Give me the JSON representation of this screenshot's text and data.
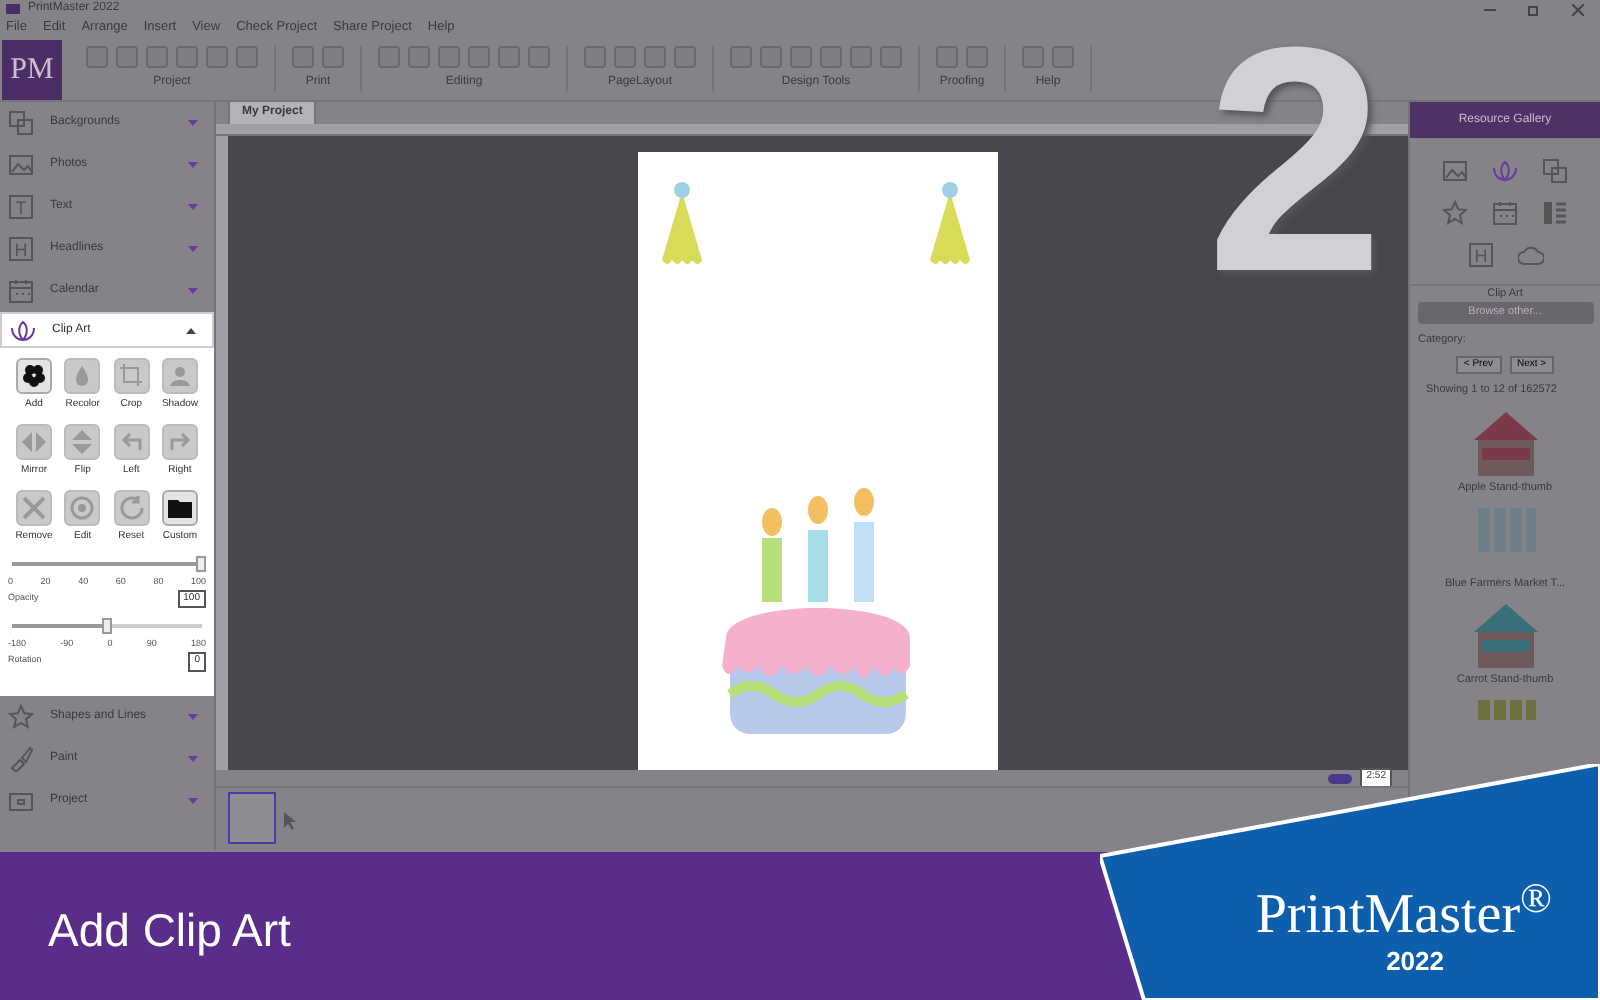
{
  "window": {
    "title": "PrintMaster 2022"
  },
  "menu": [
    "File",
    "Edit",
    "Arrange",
    "Insert",
    "View",
    "Check Project",
    "Share Project",
    "Help"
  ],
  "ribbon": {
    "logo": "PM",
    "groups": [
      {
        "label": "Project"
      },
      {
        "label": "Print"
      },
      {
        "label": "Editing"
      },
      {
        "label": "PageLayout"
      },
      {
        "label": "Design Tools"
      },
      {
        "label": "Proofing"
      },
      {
        "label": "Help"
      }
    ]
  },
  "document_tab": {
    "label": "My Project",
    "selected": true
  },
  "left_panel": {
    "sections": [
      {
        "label": "Backgrounds",
        "expanded": false
      },
      {
        "label": "Photos",
        "expanded": false
      },
      {
        "label": "Text",
        "icon_text": "T",
        "expanded": false
      },
      {
        "label": "Headlines",
        "icon_text": "H",
        "expanded": false
      },
      {
        "label": "Calendar",
        "expanded": false
      },
      {
        "label": "Clip Art",
        "expanded": true,
        "tools": [
          {
            "label": "Add",
            "disabled": false
          },
          {
            "label": "Recolor",
            "disabled": true
          },
          {
            "label": "Crop",
            "disabled": true
          },
          {
            "label": "Shadow",
            "disabled": true
          },
          {
            "label": "Mirror",
            "disabled": true
          },
          {
            "label": "Flip",
            "disabled": true
          },
          {
            "label": "Left",
            "disabled": true
          },
          {
            "label": "Right",
            "disabled": true
          },
          {
            "label": "Remove",
            "disabled": true
          },
          {
            "label": "Edit",
            "disabled": true
          },
          {
            "label": "Reset",
            "disabled": true
          },
          {
            "label": "Custom",
            "disabled": false
          }
        ],
        "sliders": [
          {
            "label": "Opacity",
            "level": 1,
            "value": "100",
            "ticks": [
              "0",
              "20",
              "40",
              "60",
              "80",
              "100"
            ]
          },
          {
            "label": "Rotation",
            "level": 0.5,
            "value": "0",
            "ticks": [
              "-180",
              "-90",
              "0",
              "90",
              "180"
            ]
          }
        ]
      },
      {
        "label": "Shapes and Lines",
        "expanded": false
      },
      {
        "label": "Paint",
        "expanded": false
      },
      {
        "label": "Project",
        "expanded": false
      }
    ]
  },
  "zoom": {
    "value": "2:52"
  },
  "pages": [
    {
      "selected": true
    }
  ],
  "resource_gallery": {
    "title": "Resource Gallery",
    "icon_text": "H",
    "section": "Clip Art",
    "browse_button": "Browse other...",
    "category_label": "Category:",
    "prev_button": "< Prev",
    "next_button": "Next >",
    "count": "Showing 1 to 12 of 162572",
    "items": [
      {
        "kind": "stand",
        "color": "#7a3a4a",
        "caption": "Apple Stand-thumb"
      },
      {
        "kind": "bars",
        "color": "#6d8088",
        "caption": "Blue Farmers Market T..."
      },
      {
        "kind": "stand",
        "color": "#3a6e78",
        "caption": "Carrot Stand-thumb"
      },
      {
        "kind": "bars",
        "color": "#6e7040"
      }
    ]
  },
  "step_number": "2",
  "banner": {
    "title": "Add Clip Art",
    "brand": "PrintMaster$^{®}$",
    "year": "2022"
  }
}
